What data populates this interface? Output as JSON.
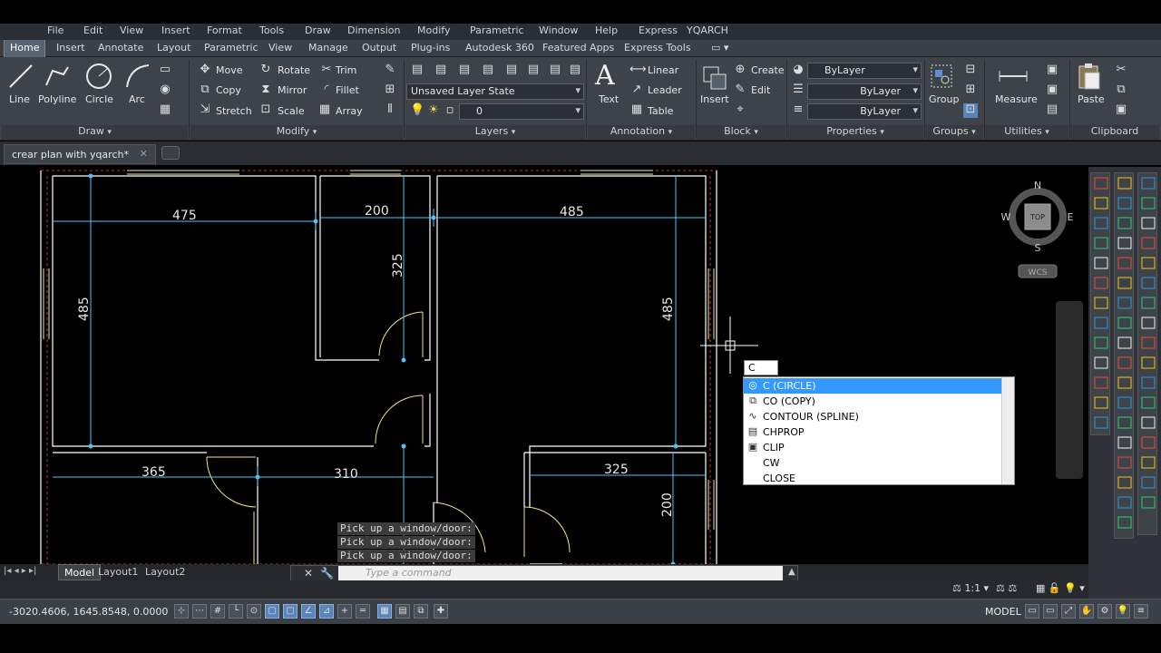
{
  "menubar": [
    "File",
    "Edit",
    "View",
    "Insert",
    "Format",
    "Tools",
    "Draw",
    "Dimension",
    "Modify",
    "Parametric",
    "Window",
    "Help",
    "Express",
    "YQARCH"
  ],
  "ribbon_tabs": [
    "Home",
    "Insert",
    "Annotate",
    "Layout",
    "Parametric",
    "View",
    "Manage",
    "Output",
    "Plug-ins",
    "Autodesk 360",
    "Featured Apps",
    "Express Tools"
  ],
  "ribbon_tab_extra": "▭ ▾",
  "panels": {
    "draw": {
      "title": "Draw",
      "line": "Line",
      "polyline": "Polyline",
      "circle": "Circle",
      "arc": "Arc"
    },
    "modify": {
      "title": "Modify",
      "move": "Move",
      "rotate": "Rotate",
      "trim": "Trim",
      "copy": "Copy",
      "mirror": "Mirror",
      "fillet": "Fillet",
      "stretch": "Stretch",
      "scale": "Scale",
      "array": "Array"
    },
    "layers": {
      "title": "Layers",
      "layer_state": "Unsaved Layer State",
      "layer": "0"
    },
    "annotation": {
      "title": "Annotation",
      "text": "Text",
      "linear": "Linear",
      "leader": "Leader",
      "table": "Table"
    },
    "block": {
      "title": "Block",
      "insert": "Insert",
      "create": "Create",
      "edit": "Edit"
    },
    "properties": {
      "title": "Properties",
      "color": "ByLayer",
      "linetype": "ByLayer",
      "lineweight": "ByLayer"
    },
    "groups": {
      "title": "Groups",
      "group": "Group"
    },
    "utilities": {
      "title": "Utilities",
      "measure": "Measure"
    },
    "clipboard": {
      "title": "Clipboard",
      "paste": "Paste"
    }
  },
  "document_tab": "crear plan with yqarch*",
  "dimensions": [
    "475",
    "200",
    "485",
    "325",
    "485",
    "485",
    "365",
    "310",
    "325",
    "200"
  ],
  "viewcube": {
    "n": "N",
    "s": "S",
    "e": "E",
    "w": "W",
    "top": "TOP",
    "wcs": "WCS"
  },
  "autocomplete": {
    "typed": "C",
    "items": [
      {
        "icon": "circle-icon",
        "glyph": "◎",
        "label": "C (CIRCLE)"
      },
      {
        "icon": "copy-icon",
        "glyph": "⧉",
        "label": "CO (COPY)"
      },
      {
        "icon": "spline-icon",
        "glyph": "∿",
        "label": "CONTOUR (SPLINE)"
      },
      {
        "icon": "chprop-icon",
        "glyph": "▤",
        "label": "CHPROP"
      },
      {
        "icon": "clip-icon",
        "glyph": "▣",
        "label": "CLIP"
      },
      {
        "icon": "blank-icon",
        "glyph": "",
        "label": "CW"
      },
      {
        "icon": "blank-icon",
        "glyph": "",
        "label": "CLOSE"
      }
    ]
  },
  "command_history": [
    "Pick up a window/door:",
    "Pick up a window/door:",
    "Pick up a window/door:"
  ],
  "command_placeholder": "Type a command",
  "layout_tabs": [
    "Model",
    "Layout1",
    "Layout2"
  ],
  "status": {
    "coords": "-3020.4606, 1645.8548, 0.0000",
    "scale": "1:1",
    "model": "MODEL"
  },
  "colors": {
    "accent": "#3399ff",
    "dimension": "#4fc3f7",
    "wall": "#ffffff",
    "door": "#f2e68a",
    "wall_hatch": "#c0392b"
  }
}
